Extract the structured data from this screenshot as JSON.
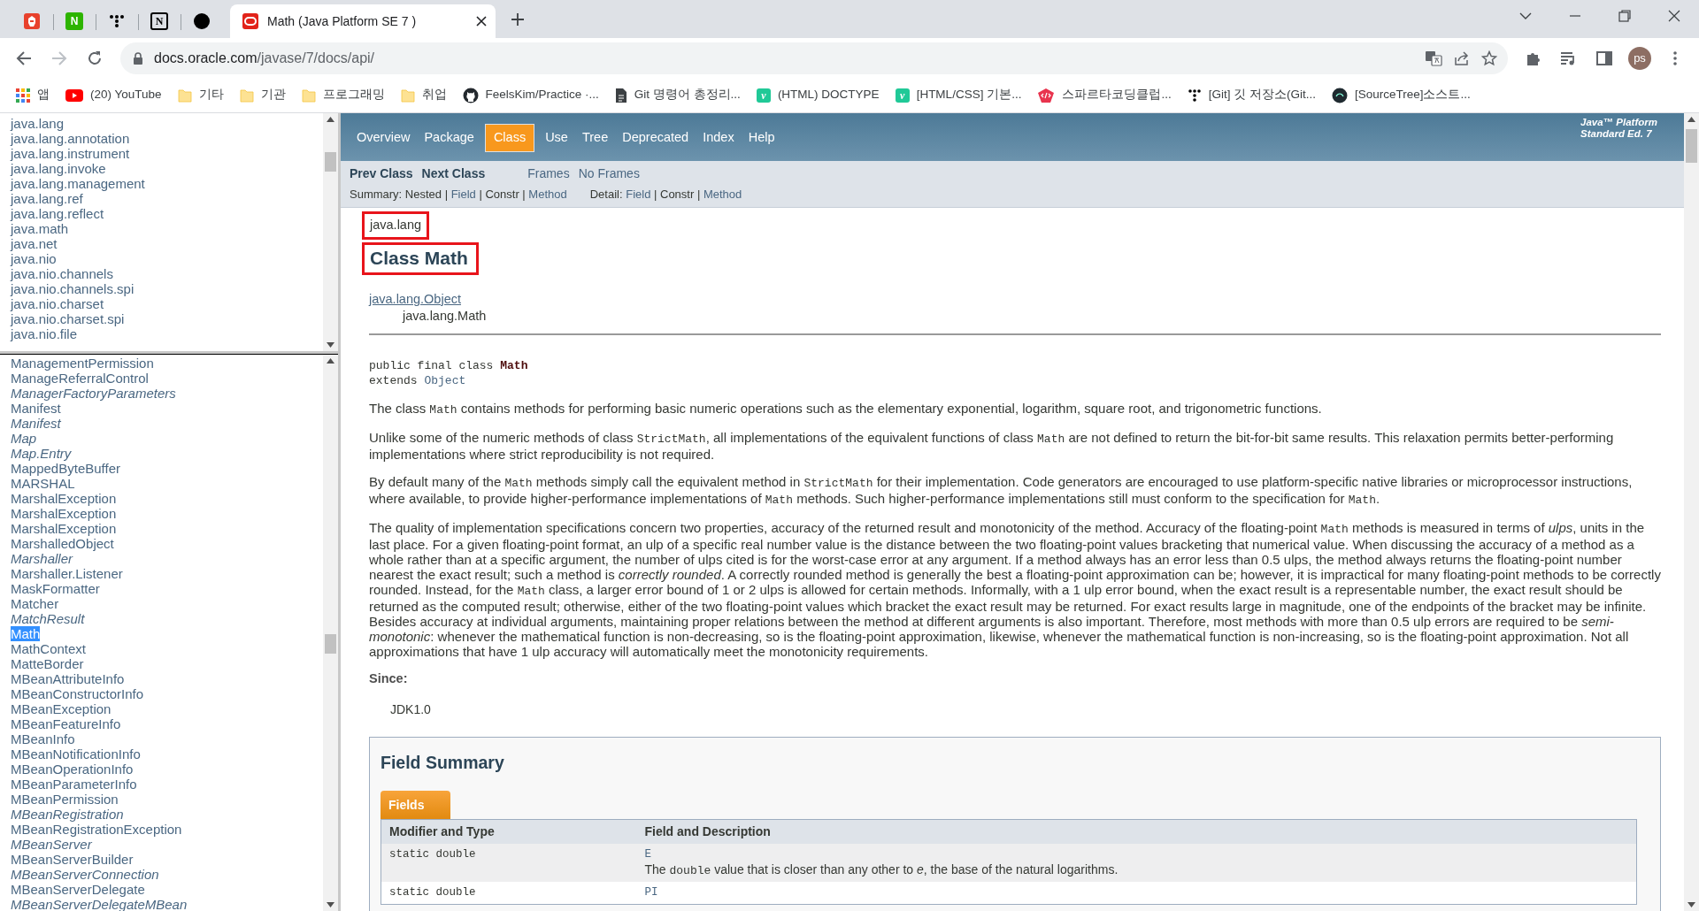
{
  "browser": {
    "pinned_tabs": [
      {
        "kind": "figure"
      },
      {
        "kind": "letter",
        "glyph": "N"
      },
      {
        "kind": "dots"
      },
      {
        "kind": "notion",
        "glyph": "N"
      },
      {
        "kind": "dot"
      }
    ],
    "active_tab": {
      "title": "Math (Java Platform SE 7 )"
    },
    "address": {
      "host": "docs.oracle.com",
      "path": "/javase/7/docs/api/"
    },
    "profile": "ps",
    "bookmarks": [
      {
        "kind": "apps",
        "label": "앱"
      },
      {
        "kind": "youtube",
        "label": "(20) YouTube"
      },
      {
        "kind": "folder",
        "label": "기타"
      },
      {
        "kind": "folder",
        "label": "기관"
      },
      {
        "kind": "folder",
        "label": "프로그래밍"
      },
      {
        "kind": "folder",
        "label": "취업"
      },
      {
        "kind": "github",
        "label": "FeelsKim/Practice ·..."
      },
      {
        "kind": "doc",
        "label": "Git 명령어 총정리..."
      },
      {
        "kind": "letter",
        "glyph": "v",
        "label": "(HTML) DOCTYPE"
      },
      {
        "kind": "letter",
        "glyph": "v",
        "label": "[HTML/CSS] 기본..."
      },
      {
        "kind": "code",
        "label": "스파르타코딩클럽..."
      },
      {
        "kind": "dots",
        "label": "[Git] 깃 저장소(Git..."
      },
      {
        "kind": "circle",
        "label": "[SourceTree]소스트..."
      }
    ]
  },
  "package_frame": {
    "items": [
      "java.lang",
      "java.lang.annotation",
      "java.lang.instrument",
      "java.lang.invoke",
      "java.lang.management",
      "java.lang.ref",
      "java.lang.reflect",
      "java.math",
      "java.net",
      "java.nio",
      "java.nio.channels",
      "java.nio.channels.spi",
      "java.nio.charset",
      "java.nio.charset.spi",
      "java.nio.file"
    ]
  },
  "class_frame": {
    "items": [
      {
        "text": "ManagementPermission",
        "italic": false,
        "selected": false
      },
      {
        "text": "ManageReferralControl",
        "italic": false,
        "selected": false
      },
      {
        "text": "ManagerFactoryParameters",
        "italic": true,
        "selected": false
      },
      {
        "text": "Manifest",
        "italic": false,
        "selected": false
      },
      {
        "text": "Manifest",
        "italic": true,
        "selected": false
      },
      {
        "text": "Map",
        "italic": true,
        "selected": false
      },
      {
        "text": "Map.Entry",
        "italic": true,
        "selected": false
      },
      {
        "text": "MappedByteBuffer",
        "italic": false,
        "selected": false
      },
      {
        "text": "MARSHAL",
        "italic": false,
        "selected": false
      },
      {
        "text": "MarshalException",
        "italic": false,
        "selected": false
      },
      {
        "text": "MarshalException",
        "italic": false,
        "selected": false
      },
      {
        "text": "MarshalException",
        "italic": false,
        "selected": false
      },
      {
        "text": "MarshalledObject",
        "italic": false,
        "selected": false
      },
      {
        "text": "Marshaller",
        "italic": true,
        "selected": false
      },
      {
        "text": "Marshaller.Listener",
        "italic": false,
        "selected": false
      },
      {
        "text": "MaskFormatter",
        "italic": false,
        "selected": false
      },
      {
        "text": "Matcher",
        "italic": false,
        "selected": false
      },
      {
        "text": "MatchResult",
        "italic": true,
        "selected": false
      },
      {
        "text": "Math",
        "italic": false,
        "selected": true
      },
      {
        "text": "MathContext",
        "italic": false,
        "selected": false
      },
      {
        "text": "MatteBorder",
        "italic": false,
        "selected": false
      },
      {
        "text": "MBeanAttributeInfo",
        "italic": false,
        "selected": false
      },
      {
        "text": "MBeanConstructorInfo",
        "italic": false,
        "selected": false
      },
      {
        "text": "MBeanException",
        "italic": false,
        "selected": false
      },
      {
        "text": "MBeanFeatureInfo",
        "italic": false,
        "selected": false
      },
      {
        "text": "MBeanInfo",
        "italic": false,
        "selected": false
      },
      {
        "text": "MBeanNotificationInfo",
        "italic": false,
        "selected": false
      },
      {
        "text": "MBeanOperationInfo",
        "italic": false,
        "selected": false
      },
      {
        "text": "MBeanParameterInfo",
        "italic": false,
        "selected": false
      },
      {
        "text": "MBeanPermission",
        "italic": false,
        "selected": false
      },
      {
        "text": "MBeanRegistration",
        "italic": true,
        "selected": false
      },
      {
        "text": "MBeanRegistrationException",
        "italic": false,
        "selected": false
      },
      {
        "text": "MBeanServer",
        "italic": true,
        "selected": false
      },
      {
        "text": "MBeanServerBuilder",
        "italic": false,
        "selected": false
      },
      {
        "text": "MBeanServerConnection",
        "italic": true,
        "selected": false
      },
      {
        "text": "MBeanServerDelegate",
        "italic": false,
        "selected": false
      },
      {
        "text": "MBeanServerDelegateMBean",
        "italic": true,
        "selected": false
      }
    ]
  },
  "doc": {
    "nav": {
      "items": [
        {
          "label": "Overview",
          "selected": false
        },
        {
          "label": "Package",
          "selected": false
        },
        {
          "label": "Class",
          "selected": true
        },
        {
          "label": "Use",
          "selected": false
        },
        {
          "label": "Tree",
          "selected": false
        },
        {
          "label": "Deprecated",
          "selected": false
        },
        {
          "label": "Index",
          "selected": false
        },
        {
          "label": "Help",
          "selected": false
        }
      ],
      "platform": [
        "Java™ Platform",
        "Standard Ed. 7"
      ]
    },
    "subnav": {
      "links": [
        {
          "text": "Prev Class",
          "bold": true
        },
        {
          "text": "Next Class",
          "bold": true
        },
        {
          "text": "Frames",
          "bold": false
        },
        {
          "text": "No Frames",
          "bold": false
        }
      ],
      "separator": "|",
      "summary": {
        "label": "Summary:",
        "items": [
          {
            "text": "Nested",
            "link": false
          },
          {
            "text": "Field",
            "link": true
          },
          {
            "text": "Constr",
            "link": false
          },
          {
            "text": "Method",
            "link": true
          }
        ]
      },
      "detail": {
        "label": "Detail:",
        "items": [
          {
            "text": "Field",
            "link": true
          },
          {
            "text": "Constr",
            "link": false
          },
          {
            "text": "Method",
            "link": true
          }
        ]
      }
    },
    "package": {
      "text": "java.lang",
      "highlighted": true
    },
    "title": {
      "text": "Class Math",
      "highlighted": true
    },
    "inheritance": [
      {
        "text": "java.lang.Object",
        "link": true
      },
      {
        "text": "java.lang.Math",
        "link": false
      }
    ],
    "signature": [
      [
        {
          "text": "public final class ",
          "kind": "plain"
        },
        {
          "text": "Math",
          "kind": "bold"
        }
      ],
      [
        {
          "text": "extends ",
          "kind": "plain"
        },
        {
          "text": "Object",
          "kind": "link"
        }
      ]
    ],
    "paragraphs": [
      [
        {
          "text": "The class ",
          "kind": "plain"
        },
        {
          "text": "Math",
          "kind": "code"
        },
        {
          "text": " contains methods for performing basic numeric operations such as the elementary exponential, logarithm, square root, and trigonometric functions.",
          "kind": "plain"
        }
      ],
      [
        {
          "text": "Unlike some of the numeric methods of class ",
          "kind": "plain"
        },
        {
          "text": "StrictMath",
          "kind": "code"
        },
        {
          "text": ", all implementations of the equivalent functions of class ",
          "kind": "plain"
        },
        {
          "text": "Math",
          "kind": "code"
        },
        {
          "text": " are not defined to return the bit-for-bit same results. This relaxation permits better-performing implementations where strict reproducibility is not required.",
          "kind": "plain"
        }
      ],
      [
        {
          "text": "By default many of the ",
          "kind": "plain"
        },
        {
          "text": "Math",
          "kind": "code"
        },
        {
          "text": " methods simply call the equivalent method in ",
          "kind": "plain"
        },
        {
          "text": "StrictMath",
          "kind": "code"
        },
        {
          "text": " for their implementation. Code generators are encouraged to use platform-specific native libraries or microprocessor instructions, where available, to provide higher-performance implementations of ",
          "kind": "plain"
        },
        {
          "text": "Math",
          "kind": "code"
        },
        {
          "text": " methods. Such higher-performance implementations still must conform to the specification for ",
          "kind": "plain"
        },
        {
          "text": "Math",
          "kind": "code"
        },
        {
          "text": ".",
          "kind": "plain"
        }
      ],
      [
        {
          "text": "The quality of implementation specifications concern two properties, accuracy of the returned result and monotonicity of the method. Accuracy of the floating-point ",
          "kind": "plain"
        },
        {
          "text": "Math",
          "kind": "code"
        },
        {
          "text": " methods is measured in terms of ",
          "kind": "plain"
        },
        {
          "text": "ulps",
          "kind": "italic"
        },
        {
          "text": ", units in the last place. For a given floating-point format, an ulp of a specific real number value is the distance between the two floating-point values bracketing that numerical value. When discussing the accuracy of a method as a whole rather than at a specific argument, the number of ulps cited is for the worst-case error at any argument. If a method always has an error less than 0.5 ulps, the method always returns the floating-point number nearest the exact result; such a method is ",
          "kind": "plain"
        },
        {
          "text": "correctly rounded",
          "kind": "italic"
        },
        {
          "text": ". A correctly rounded method is generally the best a floating-point approximation can be; however, it is impractical for many floating-point methods to be correctly rounded. Instead, for the ",
          "kind": "plain"
        },
        {
          "text": "Math",
          "kind": "code"
        },
        {
          "text": " class, a larger error bound of 1 or 2 ulps is allowed for certain methods. Informally, with a 1 ulp error bound, when the exact result is a representable number, the exact result should be returned as the computed result; otherwise, either of the two floating-point values which bracket the exact result may be returned. For exact results large in magnitude, one of the endpoints of the bracket may be infinite. Besides accuracy at individual arguments, maintaining proper relations between the method at different arguments is also important. Therefore, most methods with more than 0.5 ulp errors are required to be ",
          "kind": "plain"
        },
        {
          "text": "semi-monotonic",
          "kind": "italic"
        },
        {
          "text": ": whenever the mathematical function is non-decreasing, so is the floating-point approximation, likewise, whenever the mathematical function is non-increasing, so is the floating-point approximation. Not all approximations that have 1 ulp accuracy will automatically meet the monotonicity requirements.",
          "kind": "plain"
        }
      ]
    ],
    "since": {
      "label": "Since:",
      "value": "JDK1.0"
    },
    "field_summary": {
      "title": "Field Summary",
      "tab": "Fields",
      "columns": [
        "Modifier and Type",
        "Field and Description"
      ],
      "rows": [
        {
          "type": "static double",
          "name": "E",
          "description": [
            {
              "text": "The ",
              "kind": "plain"
            },
            {
              "text": "double",
              "kind": "code"
            },
            {
              "text": " value that is closer than any other to ",
              "kind": "plain"
            },
            {
              "text": "e",
              "kind": "italic"
            },
            {
              "text": ", the base of the natural logarithms.",
              "kind": "plain"
            }
          ]
        },
        {
          "type": "static double",
          "name": "PI"
        }
      ]
    }
  }
}
